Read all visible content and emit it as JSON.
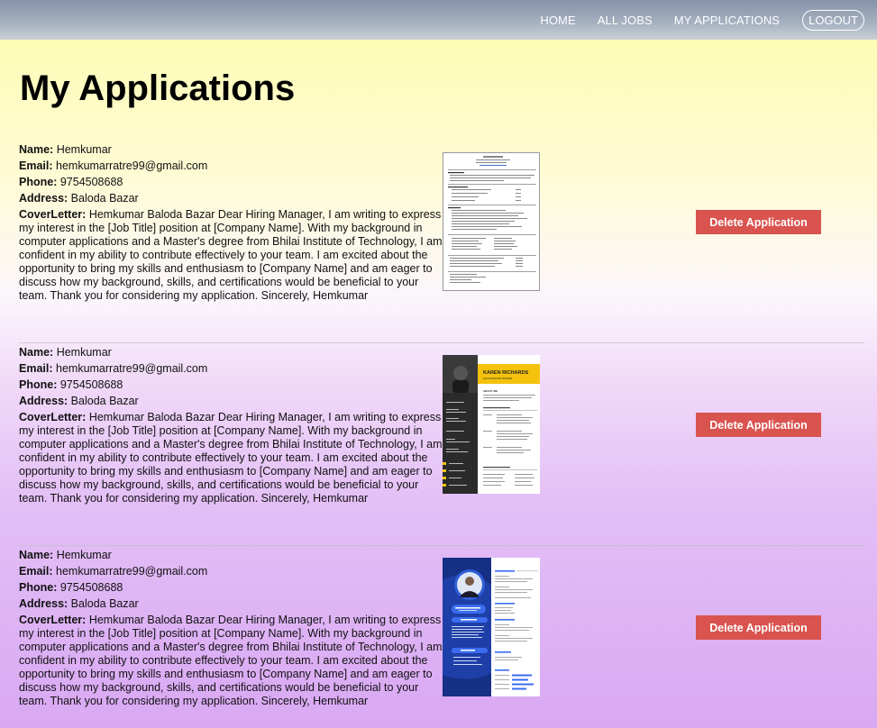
{
  "nav": {
    "home": "HOME",
    "all_jobs": "ALL JOBS",
    "my_applications": "MY APPLICATIONS",
    "logout": "LOGOUT"
  },
  "page_title": "My Applications",
  "labels": {
    "name": "Name:",
    "email": "Email:",
    "phone": "Phone:",
    "address": "Address:",
    "cover_letter": "CoverLetter:"
  },
  "resume_2": {
    "name": "KAREN RICHARDS",
    "role": "ACCOUNTING INTERN",
    "about": "ABOUT ME"
  },
  "applications": [
    {
      "name": "Hemkumar",
      "email": "hemkumarratre99@gmail.com",
      "phone": "9754508688",
      "address": "Baloda Bazar",
      "cover_letter": "Hemkumar Baloda Bazar Dear Hiring Manager, I am writing to express my interest in the [Job Title] position at [Company Name]. With my background in computer applications and a Master's degree from Bhilai Institute of Technology, I am confident in my ability to contribute effectively to your team. I am excited about the opportunity to bring my skills and enthusiasm to [Company Name] and am eager to discuss how my background, skills, and certifications would be beneficial to your team. Thank you for considering my application. Sincerely, Hemkumar",
      "delete_label": "Delete Application"
    },
    {
      "name": "Hemkumar",
      "email": "hemkumarratre99@gmail.com",
      "phone": "9754508688",
      "address": "Baloda Bazar",
      "cover_letter": "Hemkumar Baloda Bazar Dear Hiring Manager, I am writing to express my interest in the [Job Title] position at [Company Name]. With my background in computer applications and a Master's degree from Bhilai Institute of Technology, I am confident in my ability to contribute effectively to your team. I am excited about the opportunity to bring my skills and enthusiasm to [Company Name] and am eager to discuss how my background, skills, and certifications would be beneficial to your team. Thank you for considering my application. Sincerely, Hemkumar",
      "delete_label": "Delete Application"
    },
    {
      "name": "Hemkumar",
      "email": "hemkumarratre99@gmail.com",
      "phone": "9754508688",
      "address": "Baloda Bazar",
      "cover_letter": "Hemkumar Baloda Bazar Dear Hiring Manager, I am writing to express my interest in the [Job Title] position at [Company Name]. With my background in computer applications and a Master's degree from Bhilai Institute of Technology, I am confident in my ability to contribute effectively to your team. I am excited about the opportunity to bring my skills and enthusiasm to [Company Name] and am eager to discuss how my background, skills, and certifications would be beneficial to your team. Thank you for considering my application. Sincerely, Hemkumar",
      "delete_label": "Delete Application"
    }
  ]
}
